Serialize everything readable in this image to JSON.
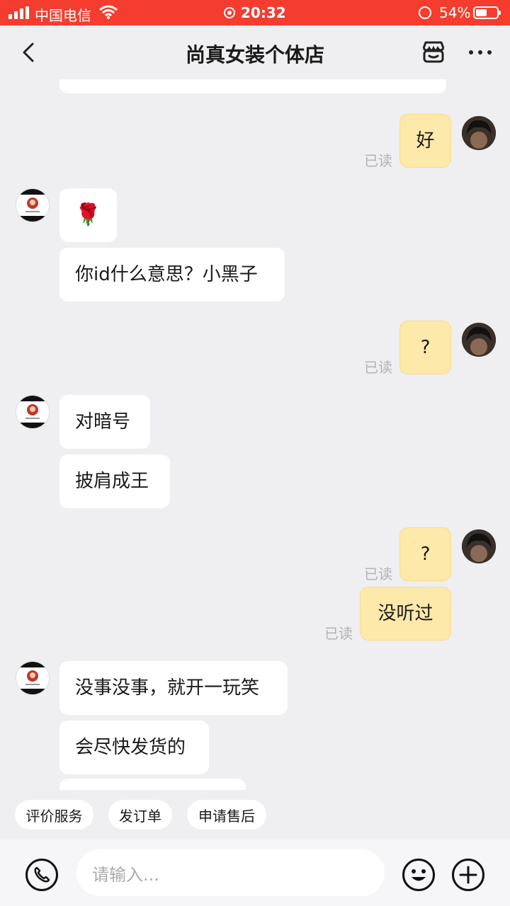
{
  "status_bar": {
    "carrier": "中国电信",
    "time": "20:32",
    "battery": "54%"
  },
  "header": {
    "title": "尚真女装个体店"
  },
  "messages": [
    {
      "text": "好",
      "read": "已读"
    },
    {
      "text": "🌹"
    },
    {
      "text": "你id什么意思？小黑子"
    },
    {
      "text": "?",
      "read": "已读"
    },
    {
      "text": "对暗号"
    },
    {
      "text": "披肩成王"
    },
    {
      "text": "?",
      "read": "已读"
    },
    {
      "text": "没听过",
      "read": "已读"
    },
    {
      "text": "没事没事，就开一玩笑"
    },
    {
      "text": "会尽快发货的"
    }
  ],
  "quick_actions": [
    "评价服务",
    "发订单",
    "申请售后"
  ],
  "input": {
    "placeholder": "请输入..."
  }
}
